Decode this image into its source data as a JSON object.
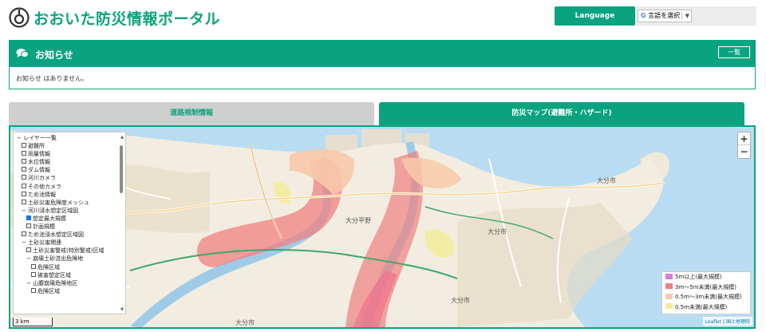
{
  "header": {
    "title": "おおいた防災情報ポータル",
    "language_button": "Language",
    "translate_label": "言語を選択"
  },
  "notice": {
    "title": "お知らせ",
    "list_button": "一覧",
    "body": "お知らせ はありません。"
  },
  "tabs": [
    {
      "label": "道路規制情報",
      "active": false
    },
    {
      "label": "防災マップ(避難所・ハザード)",
      "active": true
    }
  ],
  "map": {
    "layers_title": "レイヤー一覧",
    "layers": [
      {
        "label": "避難所",
        "checked": false,
        "level": 1
      },
      {
        "label": "雨量情報",
        "checked": false,
        "level": 1
      },
      {
        "label": "水位情報",
        "checked": false,
        "level": 1
      },
      {
        "label": "ダム情報",
        "checked": false,
        "level": 1
      },
      {
        "label": "河川カメラ",
        "checked": false,
        "level": 1
      },
      {
        "label": "その他カメラ",
        "checked": false,
        "level": 1
      },
      {
        "label": "ため池情報",
        "checked": false,
        "level": 1
      },
      {
        "label": "土砂災害危険度メッシュ",
        "checked": false,
        "level": 1
      },
      {
        "label": "河川浸水想定区域図",
        "group": true,
        "level": 1
      },
      {
        "label": "想定最大規模",
        "checked": true,
        "level": 2
      },
      {
        "label": "計画規模",
        "checked": false,
        "level": 2
      },
      {
        "label": "ため池浸水想定区域図",
        "checked": false,
        "level": 1
      },
      {
        "label": "土砂災害関連",
        "group": true,
        "level": 1
      },
      {
        "label": "土砂災害警戒(特別警戒)区域",
        "checked": false,
        "level": 2
      },
      {
        "label": "崩壊土砂流出危険地",
        "group": true,
        "level": 2
      },
      {
        "label": "危険区域",
        "checked": false,
        "level": 3
      },
      {
        "label": "被害想定区域",
        "checked": false,
        "level": 3
      },
      {
        "label": "山腹崩壊危険地区",
        "group": true,
        "level": 2
      },
      {
        "label": "危険区域",
        "checked": false,
        "level": 3
      }
    ],
    "zoom_in": "+",
    "zoom_out": "−",
    "legend": [
      {
        "label": "5m以上(最大規模)",
        "color": "#dc7ad8"
      },
      {
        "label": "3m〜5m未満(最大規模)",
        "color": "#f08080"
      },
      {
        "label": "0.5m〜3m未満(最大規模)",
        "color": "#f8c9a8"
      },
      {
        "label": "0.5m未満(最大規模)",
        "color": "#f3eb9e"
      }
    ],
    "scale_label": "3 km",
    "attribution": {
      "leaflet": "Leaflet",
      "separator": "|",
      "gsi": "国土地理院"
    },
    "place_labels": [
      "大分平野",
      "大分市",
      "大分市",
      "大分市",
      "大分市"
    ]
  },
  "colors": {
    "accent": "#0aa37f",
    "sea": "#b9dcf2"
  }
}
